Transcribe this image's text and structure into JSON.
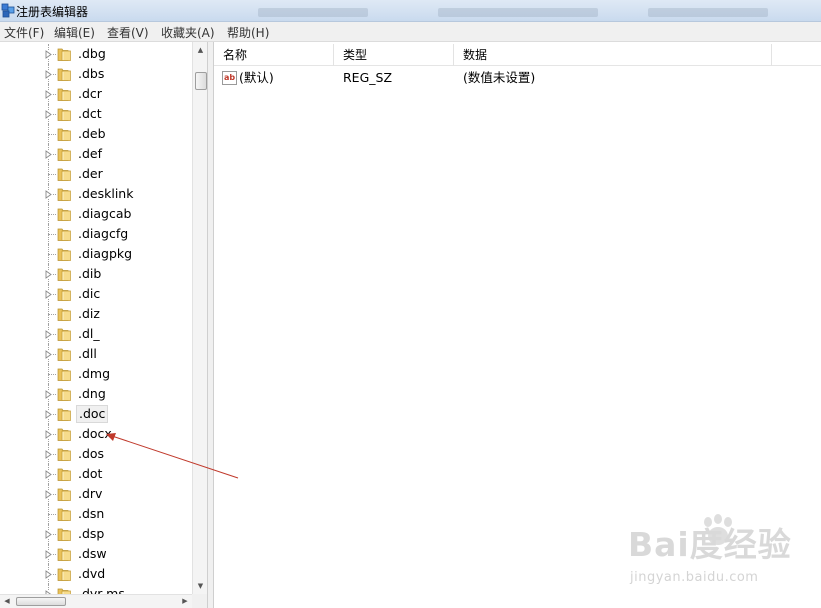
{
  "window": {
    "title": "注册表编辑器",
    "accent_color": "#c9daee"
  },
  "menubar": {
    "items": [
      {
        "label": "文件(F)"
      },
      {
        "label": "编辑(E)"
      },
      {
        "label": "查看(V)"
      },
      {
        "label": "收藏夹(A)"
      },
      {
        "label": "帮助(H)"
      }
    ]
  },
  "tree": {
    "folder_icon": "folder-icon",
    "items": [
      {
        "label": ".dbg",
        "expandable": true
      },
      {
        "label": ".dbs",
        "expandable": true
      },
      {
        "label": ".dcr",
        "expandable": true
      },
      {
        "label": ".dct",
        "expandable": true
      },
      {
        "label": ".deb",
        "expandable": false
      },
      {
        "label": ".def",
        "expandable": true
      },
      {
        "label": ".der",
        "expandable": false
      },
      {
        "label": ".desklink",
        "expandable": true
      },
      {
        "label": ".diagcab",
        "expandable": false
      },
      {
        "label": ".diagcfg",
        "expandable": false
      },
      {
        "label": ".diagpkg",
        "expandable": false
      },
      {
        "label": ".dib",
        "expandable": true
      },
      {
        "label": ".dic",
        "expandable": true
      },
      {
        "label": ".diz",
        "expandable": false
      },
      {
        "label": ".dl_",
        "expandable": true
      },
      {
        "label": ".dll",
        "expandable": true
      },
      {
        "label": ".dmg",
        "expandable": false
      },
      {
        "label": ".dng",
        "expandable": true
      },
      {
        "label": ".doc",
        "expandable": true,
        "selected": true
      },
      {
        "label": ".docx",
        "expandable": true
      },
      {
        "label": ".dos",
        "expandable": true
      },
      {
        "label": ".dot",
        "expandable": true
      },
      {
        "label": ".drv",
        "expandable": true
      },
      {
        "label": ".dsn",
        "expandable": false
      },
      {
        "label": ".dsp",
        "expandable": true
      },
      {
        "label": ".dsw",
        "expandable": true
      },
      {
        "label": ".dvd",
        "expandable": true
      },
      {
        "label": ".dvr-ms",
        "expandable": true
      }
    ]
  },
  "list": {
    "columns": [
      {
        "label": "名称"
      },
      {
        "label": "类型"
      },
      {
        "label": "数据"
      }
    ],
    "rows": [
      {
        "icon": "string-value-icon",
        "name": "(默认)",
        "type": "REG_SZ",
        "data": "(数值未设置)"
      }
    ]
  },
  "annotation": {
    "kind": "arrow",
    "color": "#c0392b",
    "points_to": ".docx"
  },
  "watermark": {
    "logo": "Bai度经验",
    "url": "jingyan.baidu.com"
  }
}
